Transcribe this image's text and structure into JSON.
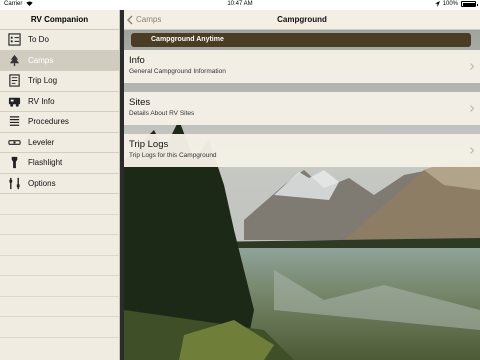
{
  "status_bar": {
    "carrier": "Carrier",
    "time": "10:47 AM",
    "battery": "100%"
  },
  "sidebar": {
    "title": "RV Companion",
    "items": [
      {
        "label": "To Do",
        "icon": "todo-icon"
      },
      {
        "label": "Camps",
        "icon": "camp-icon",
        "selected": true
      },
      {
        "label": "Trip Log",
        "icon": "trip-log-icon"
      },
      {
        "label": "RV Info",
        "icon": "rv-icon"
      },
      {
        "label": "Procedures",
        "icon": "procedures-icon"
      },
      {
        "label": "Leveler",
        "icon": "leveler-icon"
      },
      {
        "label": "Flashlight",
        "icon": "flashlight-icon"
      },
      {
        "label": "Options",
        "icon": "options-icon"
      }
    ]
  },
  "nav": {
    "back_label": "Camps",
    "title": "Campground"
  },
  "banner": "Campground Anytime",
  "rows": [
    {
      "title": "Info",
      "subtitle": "General Campground Information"
    },
    {
      "title": "Sites",
      "subtitle": "Details About RV Sites"
    },
    {
      "title": "Trip Logs",
      "subtitle": "Trip Logs for this Campground"
    }
  ],
  "colors": {
    "sidebar_bg": "#f1ece1",
    "selected_bg": "#d1ccc0",
    "banner_bg": "#4b3c24",
    "accent_brown": "#8a8171"
  }
}
